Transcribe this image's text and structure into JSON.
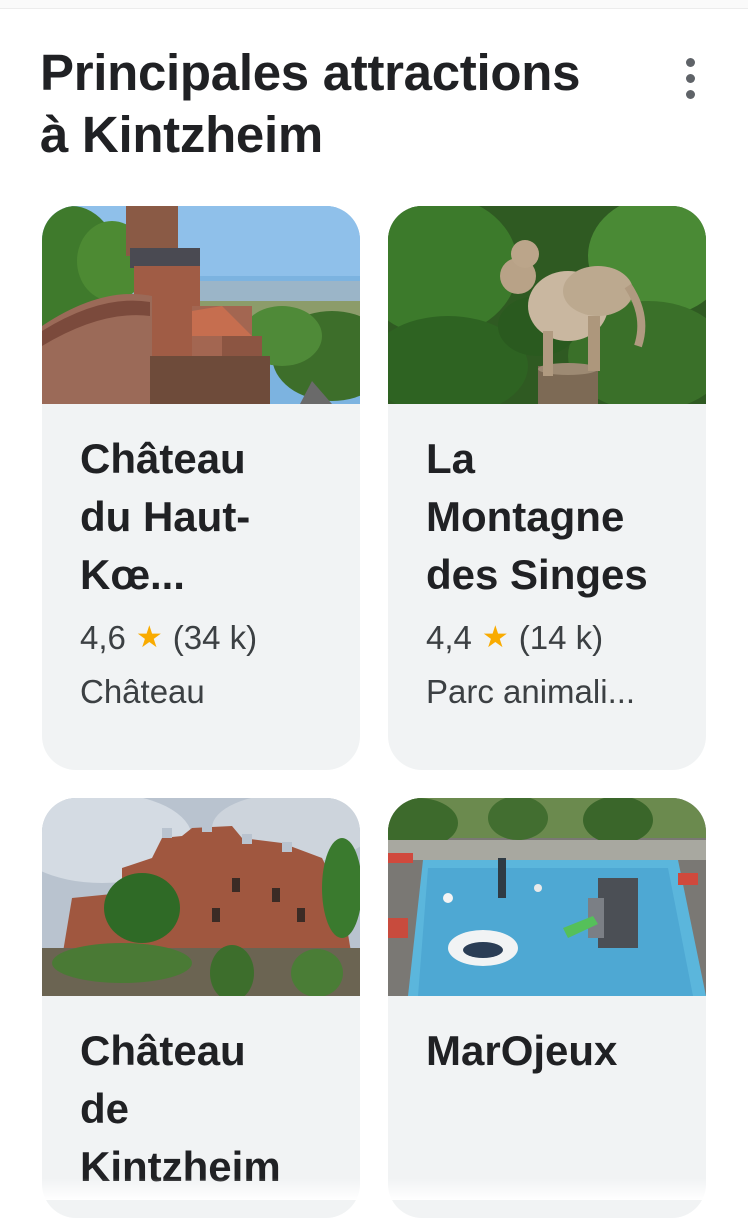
{
  "header": {
    "title_line1": "Principales attractions",
    "title_line2": "à Kintzheim",
    "more_icon": "more-vert-icon"
  },
  "attractions": [
    {
      "name": "Château du Haut-Kœ...",
      "rating": "4,6",
      "reviews": "(34 k)",
      "category": "Château",
      "image": "castle-panorama-photo"
    },
    {
      "name": "La Montagne des Singes",
      "rating": "4,4",
      "reviews": "(14 k)",
      "category": "Parc animali...",
      "image": "barbary-macaques-photo"
    },
    {
      "name": "Château de Kintzheim",
      "image": "castle-ruins-photo"
    },
    {
      "name": "MarOjeux",
      "image": "water-playground-photo"
    }
  ],
  "colors": {
    "star": "#f9ab00",
    "card_bg": "#f1f3f4",
    "text": "#202124"
  }
}
